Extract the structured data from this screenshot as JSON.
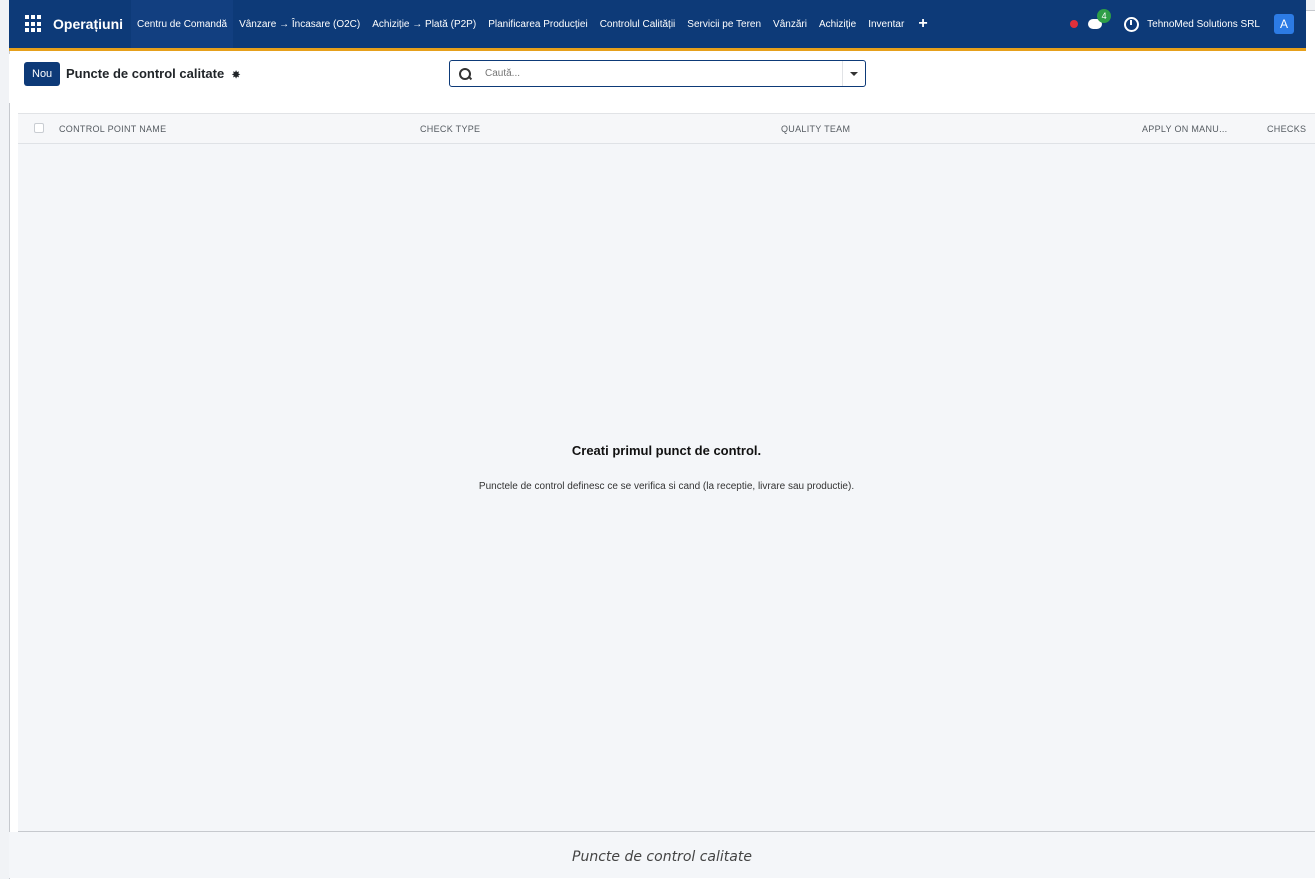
{
  "navbar": {
    "brand": "Operațiuni",
    "menu": [
      "Centru de Comandă",
      "Vânzare → Încasare (O2C)",
      "Achiziție → Plată (P2P)",
      "Planificarea Producției",
      "Controlul Calității",
      "Servicii pe Teren",
      "Vânzări",
      "Achiziție",
      "Inventar"
    ],
    "chat_badge": "4",
    "company": "TehnoMed Solutions SRL",
    "avatar": "A"
  },
  "control_panel": {
    "new_button": "Nou",
    "page_title": "Puncte de control calitate",
    "search_placeholder": "Caută..."
  },
  "table": {
    "columns": [
      "CONTROL POINT NAME",
      "CHECK TYPE",
      "QUALITY TEAM",
      "APPLY ON MANU...",
      "CHECKS"
    ]
  },
  "empty_state": {
    "title": "Creati primul punct de control.",
    "text": "Punctele de control definesc ce se verifica si cand (la receptie, livrare sau productie)."
  },
  "caption": "Puncte de control calitate",
  "colors": {
    "navbar": "#0d3a78",
    "accent_border": "#e6a01b",
    "badge": "#2e9e47",
    "avatar": "#2c7be5"
  }
}
